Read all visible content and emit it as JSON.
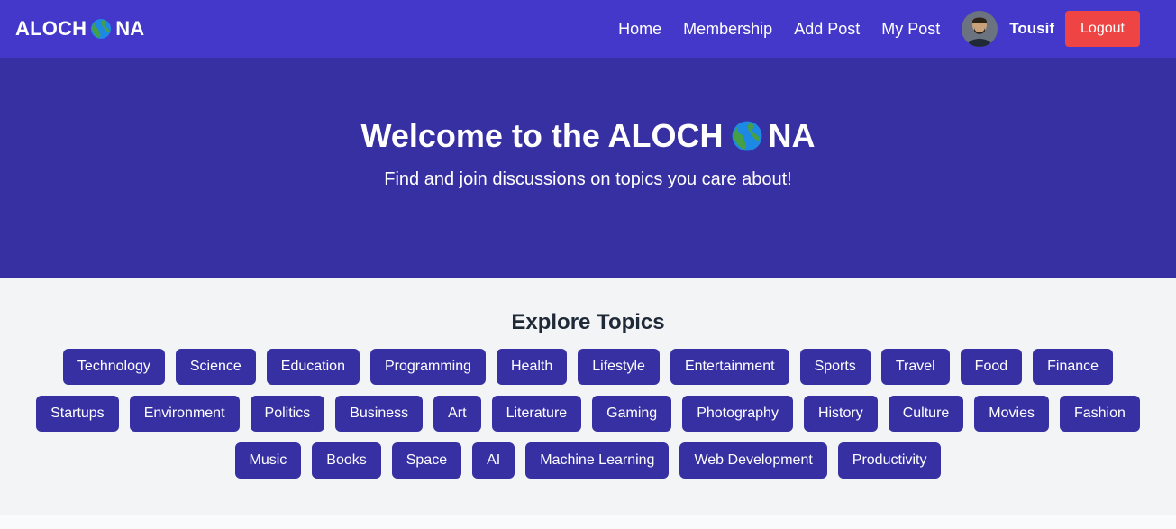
{
  "brand": {
    "before": "ALOCH",
    "after": "NA",
    "globe_icon": "globe-americas-icon"
  },
  "nav": {
    "links": [
      "Home",
      "Membership",
      "Add Post",
      "My Post"
    ],
    "username": "Tousif",
    "logout_label": "Logout"
  },
  "hero": {
    "title_before": "Welcome to the ALOCH",
    "title_after": "NA",
    "subtitle": "Find and join discussions on topics you care about!"
  },
  "topics": {
    "title": "Explore Topics",
    "rows": [
      [
        "Technology",
        "Science",
        "Education",
        "Programming",
        "Health",
        "Lifestyle",
        "Entertainment",
        "Sports",
        "Travel",
        "Food",
        "Finance"
      ],
      [
        "Startups",
        "Environment",
        "Politics",
        "Business",
        "Art",
        "Literature",
        "Gaming",
        "Photography",
        "History",
        "Culture",
        "Movies",
        "Fashion"
      ],
      [
        "Music",
        "Books",
        "Space",
        "AI",
        "Machine Learning",
        "Web Development",
        "Productivity"
      ]
    ]
  },
  "colors": {
    "navbar": "#4338ca",
    "hero": "#3730a3",
    "chip": "#3730a3",
    "logout": "#ef4444",
    "section_bg": "#f3f4f6"
  }
}
